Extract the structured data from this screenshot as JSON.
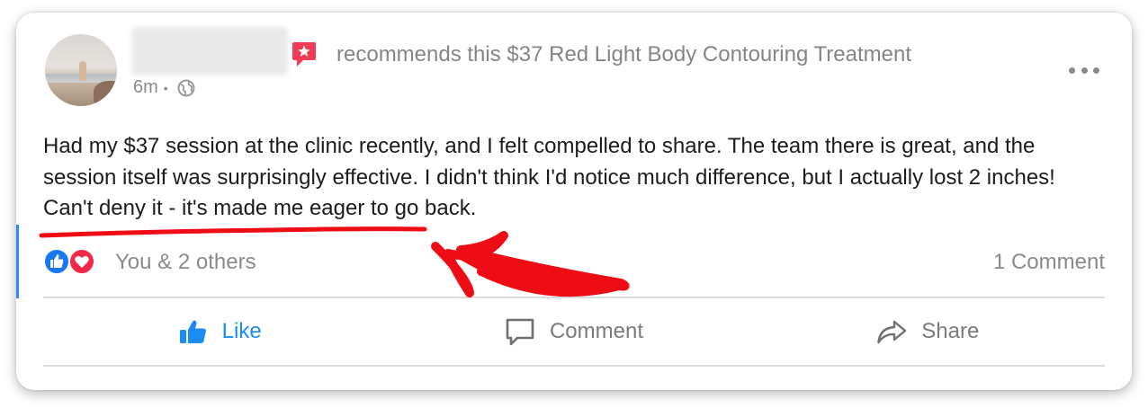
{
  "post": {
    "author_name": "",
    "headline": "recommends this $37 Red Light Body Contouring Treatment",
    "time": "6m",
    "separator": "•",
    "audience_icon": "globe-icon",
    "recommend_icon": "recommend-star-icon",
    "more_icon": "more-options-icon",
    "body": "Had my $37 session at the clinic recently, and I felt compelled to share. The team there is great, and the session itself was surprisingly effective. I didn't think I'd notice much difference, but I actually lost 2 inches! Can't deny it - it's made me eager to go back."
  },
  "reactions": {
    "summary": "You & 2 others",
    "types": [
      "like-icon",
      "love-icon"
    ],
    "comments": "1 Comment"
  },
  "actions": {
    "like": "Like",
    "comment": "Comment",
    "share": "Share"
  },
  "colors": {
    "like_blue": "#1b8df2",
    "love_red": "#f0284a",
    "recommend_red": "#f03c57",
    "annotation_red": "#ee0d15",
    "accent_bar": "#2d88ff"
  }
}
